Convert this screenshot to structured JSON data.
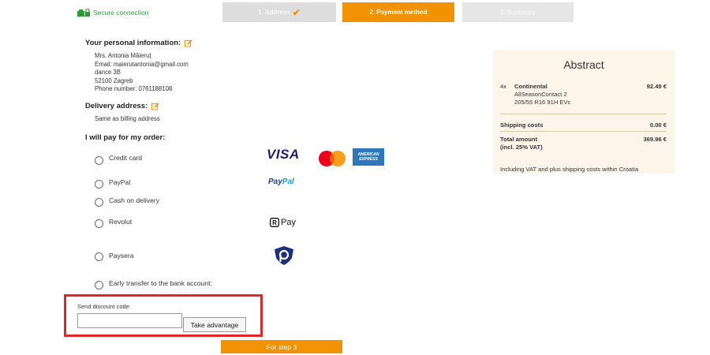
{
  "header": {
    "secure_label": "Secure connection",
    "steps": [
      {
        "label": "1. Address",
        "state": "done"
      },
      {
        "label": "2. Payment method",
        "state": "active"
      },
      {
        "label": "3. Summary",
        "state": "pending"
      }
    ]
  },
  "personal": {
    "heading": "Your personal information:",
    "lines": [
      "Mrs. Antonia Măieruț",
      "Email: maierutantonia@gmail.com",
      "dance 3B",
      "52100 Zagreb",
      "Phone number: 0761188108"
    ]
  },
  "delivery": {
    "heading": "Delivery address:",
    "text": "Same as billing address"
  },
  "payment": {
    "heading": "I will pay for my order:",
    "options": [
      {
        "label": "Credit card",
        "logos": [
          "visa-logo",
          "mastercard-logo",
          "amex-logo"
        ]
      },
      {
        "label": "PayPal",
        "logos": [
          "paypal-logo"
        ]
      },
      {
        "label": "Cash on delivery",
        "logos": []
      },
      {
        "label": "Revolut",
        "logos": [
          "revolut-pay-logo"
        ]
      },
      {
        "label": "Paysera",
        "logos": [
          "paysera-logo"
        ]
      },
      {
        "label": "Early transfer to the bank account:",
        "logos": []
      }
    ],
    "logo_text": {
      "visa": "VISA",
      "paypal_1": "Pay",
      "paypal_2": "Pal",
      "rpay": "Pay",
      "amex_1": "AMERICAN",
      "amex_2": "EXPRESS"
    }
  },
  "discount": {
    "label": "Send discount code",
    "input_value": "",
    "input_placeholder": "",
    "button_label": "Take advantage"
  },
  "next_button": "For step 3",
  "abstract": {
    "title": "Abstract",
    "item": {
      "qty": "4x",
      "brand": "Continental",
      "model": "AllSeasonContact 2",
      "size": "205/55 R16 91H EVc",
      "price": "92.49 €"
    },
    "shipping_label": "Shipping costs",
    "shipping_value": "0.00 €",
    "total_label": "Total amount",
    "total_sub": "(incl. 25% VAT)",
    "total_value": "369.96 €",
    "note": "Including VAT and plus shipping costs within Croatia"
  },
  "colors": {
    "accent": "#f39200",
    "secure": "#2e9a3a",
    "highlight": "#e3242b",
    "summary_bg": "#fdf5ea"
  }
}
